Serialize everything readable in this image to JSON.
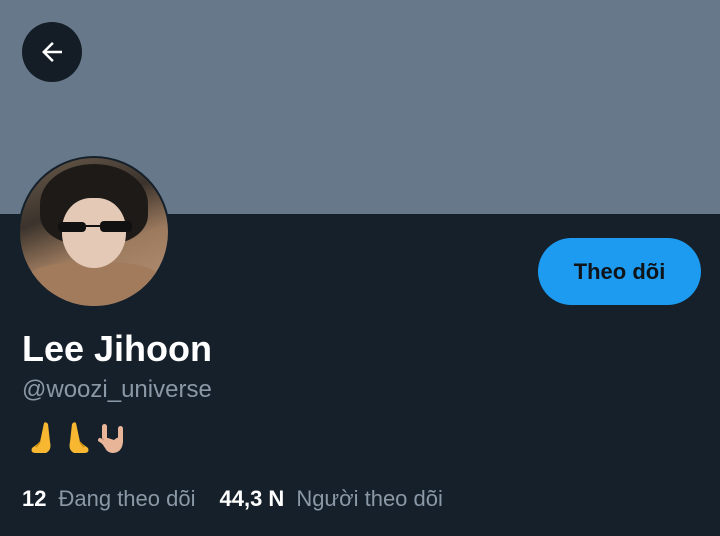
{
  "header": {
    "back_icon": "arrow-left-icon"
  },
  "colors": {
    "banner": "#66788a",
    "background": "#15202b",
    "accent": "#1d9bf0",
    "muted": "#8b98a5"
  },
  "profile": {
    "name": "Lee Jihoon",
    "handle": "@woozi_universe",
    "bio_emojis": [
      "🙏",
      "🙏",
      "🤟"
    ],
    "follow_label": "Theo dõi"
  },
  "stats": {
    "following_count": "12",
    "following_label": "Đang theo dõi",
    "followers_count": "44,3 N",
    "followers_label": "Người theo dõi"
  }
}
